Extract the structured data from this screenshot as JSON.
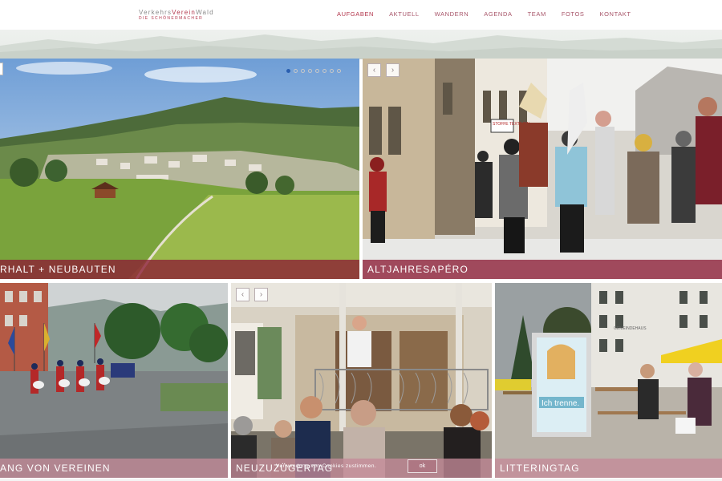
{
  "header": {
    "logo_part1": "Verkehrs",
    "logo_part2": "Verein",
    "logo_part3": "Wald",
    "logo_subtitle": "DIE SCHÖNERMACHER",
    "nav": [
      {
        "label": "AUFGABEN",
        "active": true
      },
      {
        "label": "AKTUELL",
        "active": false
      },
      {
        "label": "WANDERN",
        "active": false
      },
      {
        "label": "AGENDA",
        "active": false
      },
      {
        "label": "TEAM",
        "active": false
      },
      {
        "label": "FOTOS",
        "active": false
      },
      {
        "label": "KONTAKT",
        "active": false
      }
    ]
  },
  "tiles": [
    {
      "caption": "RHALT + NEUBAUTEN",
      "image": "village-landscape-photo"
    },
    {
      "caption": "ALTJAHRESAPÉRO",
      "image": "new-year-parade-photo"
    },
    {
      "caption": "ANG VON VEREINEN",
      "image": "marching-band-photo"
    },
    {
      "caption": "NEUZUZÜGERTAG",
      "image": "house-balcony-gathering-photo"
    },
    {
      "caption": "LITTERINGTAG",
      "image": "litter-day-stand-photo"
    }
  ],
  "slider": {
    "dot_count": 8,
    "active_dot": 1
  },
  "poster_text": "Ich trenne.",
  "sign_text": "STOFFE TEXTILIEN",
  "building_sign": "GEMEINDEHAUS",
  "arrows": {
    "prev": "‹",
    "next": "›"
  },
  "cookie": {
    "text": "Verwendung von Cookies zustimmen.",
    "button": "ok"
  },
  "colors": {
    "accent": "#b3364c",
    "caption_dark": "#8c1c34",
    "caption_light": "#c48a98"
  }
}
